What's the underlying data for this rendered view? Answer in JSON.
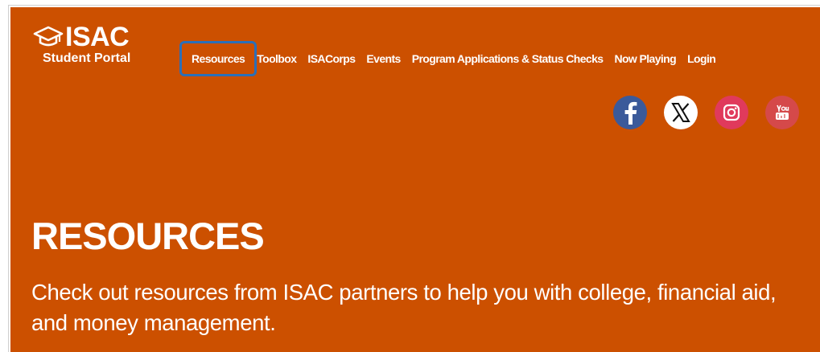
{
  "logo": {
    "name": "ISAC",
    "subtitle": "Student Portal"
  },
  "nav": {
    "items": [
      {
        "label": "Resources",
        "active": true
      },
      {
        "label": "Toolbox"
      },
      {
        "label": "ISACorps"
      },
      {
        "label": "Events"
      },
      {
        "label": "Program Applications & Status Checks"
      },
      {
        "label": "Now Playing"
      },
      {
        "label": "Login"
      }
    ]
  },
  "social": {
    "icons": [
      "facebook-icon",
      "x-icon",
      "instagram-icon",
      "youtube-icon"
    ]
  },
  "hero": {
    "title": "RESOURCES",
    "description": "Check out resources from ISAC partners to help you with college, financial aid, and money management."
  },
  "colors": {
    "background": "#cc5000",
    "highlight": "#2b6fb7",
    "facebook": "#3b5a9a",
    "instagram": "#e03a5c",
    "youtube": "#d5494a"
  }
}
